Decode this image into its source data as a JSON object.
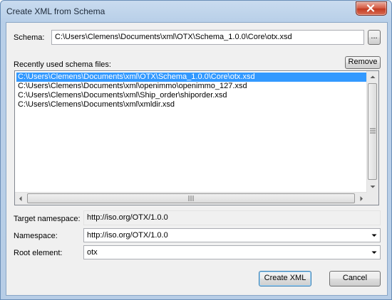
{
  "window": {
    "title": "Create XML from Schema"
  },
  "schema": {
    "label": "Schema:",
    "value": "C:\\Users\\Clemens\\Documents\\xml\\OTX\\Schema_1.0.0\\Core\\otx.xsd",
    "browse_label": "..."
  },
  "recent": {
    "label": "Recently used schema files:",
    "remove_label": "Remove",
    "items": [
      "C:\\Users\\Clemens\\Documents\\xml\\OTX\\Schema_1.0.0\\Core\\otx.xsd",
      "C:\\Users\\Clemens\\Documents\\xml\\openimmo\\openimmo_127.xsd",
      "C:\\Users\\Clemens\\Documents\\xml\\Ship_order\\shiporder.xsd",
      "C:\\Users\\Clemens\\Documents\\xml\\xmldir.xsd"
    ]
  },
  "target_namespace": {
    "label": "Target namespace:",
    "value": "http://iso.org/OTX/1.0.0"
  },
  "namespace": {
    "label": "Namespace:",
    "value": "http://iso.org/OTX/1.0.0"
  },
  "root_element": {
    "label": "Root element:",
    "value": "otx"
  },
  "buttons": {
    "create_label": "Create XML",
    "cancel_label": "Cancel"
  },
  "colors": {
    "selection": "#3399ff",
    "title_bar": "#c9dbef",
    "close_button": "#c23b22"
  }
}
